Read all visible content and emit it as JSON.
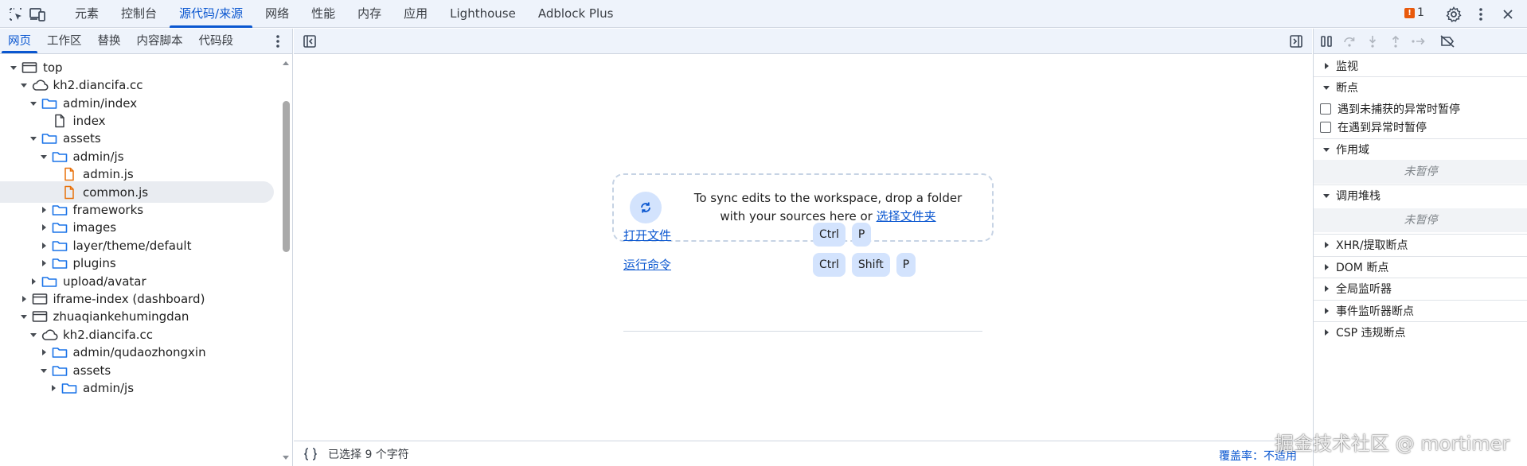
{
  "topbar": {
    "tabs": [
      "元素",
      "控制台",
      "源代码/来源",
      "网络",
      "性能",
      "内存",
      "应用",
      "Lighthouse",
      "Adblock Plus"
    ],
    "active_tab": "源代码/来源",
    "issues_count": "1"
  },
  "navigator": {
    "tabs": [
      "网页",
      "工作区",
      "替换",
      "内容脚本",
      "代码段"
    ],
    "active_tab": "网页",
    "tree": [
      {
        "label": "top",
        "depth": 0,
        "expanded": true,
        "icon": "frame-icon"
      },
      {
        "label": "kh2.diancifa.cc",
        "depth": 1,
        "expanded": true,
        "icon": "cloud-icon"
      },
      {
        "label": "admin/index",
        "depth": 2,
        "expanded": true,
        "icon": "folder-icon"
      },
      {
        "label": "index",
        "depth": 3,
        "expanded": null,
        "icon": "document-icon"
      },
      {
        "label": "assets",
        "depth": 2,
        "expanded": true,
        "icon": "folder-icon"
      },
      {
        "label": "admin/js",
        "depth": 3,
        "expanded": true,
        "icon": "folder-icon"
      },
      {
        "label": "admin.js",
        "depth": 4,
        "expanded": null,
        "icon": "script-file-icon"
      },
      {
        "label": "common.js",
        "depth": 4,
        "expanded": null,
        "icon": "script-file-icon",
        "selected": true
      },
      {
        "label": "frameworks",
        "depth": 3,
        "expanded": false,
        "icon": "folder-icon"
      },
      {
        "label": "images",
        "depth": 3,
        "expanded": false,
        "icon": "folder-icon"
      },
      {
        "label": "layer/theme/default",
        "depth": 3,
        "expanded": false,
        "icon": "folder-icon"
      },
      {
        "label": "plugins",
        "depth": 3,
        "expanded": false,
        "icon": "folder-icon"
      },
      {
        "label": "upload/avatar",
        "depth": 2,
        "expanded": false,
        "icon": "folder-icon"
      },
      {
        "label": "iframe-index (dashboard)",
        "depth": 1,
        "expanded": false,
        "icon": "frame-icon"
      },
      {
        "label": "zhuaqiankehumingdan",
        "depth": 1,
        "expanded": true,
        "icon": "frame-icon"
      },
      {
        "label": "kh2.diancifa.cc",
        "depth": 2,
        "expanded": true,
        "icon": "cloud-icon"
      },
      {
        "label": "admin/qudaozhongxin",
        "depth": 3,
        "expanded": false,
        "icon": "folder-icon"
      },
      {
        "label": "assets",
        "depth": 3,
        "expanded": true,
        "icon": "folder-icon"
      },
      {
        "label": "admin/js",
        "depth": 4,
        "expanded": false,
        "icon": "folder-icon"
      }
    ]
  },
  "editor": {
    "drop_text": "To sync edits to the workspace, drop a folder with your sources here or ",
    "drop_link": "选择文件夹",
    "shortcuts": [
      {
        "label": "打开文件",
        "keys": [
          "Ctrl",
          "P"
        ]
      },
      {
        "label": "运行命令",
        "keys": [
          "Ctrl",
          "Shift",
          "P"
        ]
      }
    ],
    "status": {
      "selection": "已选择 9 个字符",
      "coverage": "覆盖率：不适用"
    }
  },
  "debugger": {
    "watch": "监视",
    "breakpoints": "断点",
    "pause_uncaught": "遇到未捕获的异常时暂停",
    "pause_caught": "在遇到异常时暂停",
    "scope": "作用域",
    "scope_empty": "未暂停",
    "callstack": "调用堆栈",
    "callstack_empty": "未暂停",
    "xhr": "XHR/提取断点",
    "dom": "DOM 断点",
    "global": "全局监听器",
    "event": "事件监听器断点",
    "csp": "CSP 违规断点"
  },
  "watermark": "掘金技术社区 @ mortimer",
  "colors": {
    "accent": "#0b57d0",
    "toolbar_bg": "#eef3fb",
    "keycap_bg": "#d3e3fd",
    "folder": "#1a73e8",
    "script_file": "#e8710a"
  }
}
